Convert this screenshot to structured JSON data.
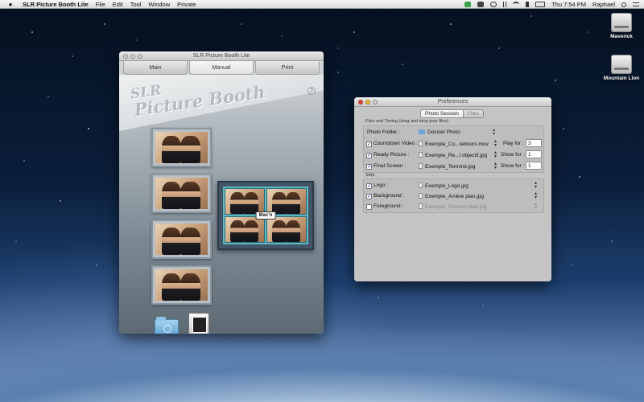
{
  "menubar": {
    "apple": "",
    "app_name": "SLR Picture Booth Lite",
    "items": [
      "File",
      "Edit",
      "Tool",
      "Window",
      "Private"
    ],
    "clock": "Thu 7:54 PM",
    "user": "Raphael"
  },
  "desktop": {
    "disks": [
      {
        "label": "Maverick"
      },
      {
        "label": "Mountain Lion"
      }
    ]
  },
  "main_window": {
    "title": "SLR Picture Booth Lite",
    "tabs": [
      "Main",
      "Manual",
      "Print"
    ],
    "active_tab": "Manual",
    "logo_line1": "SLR",
    "logo_line2": "Picture Booth",
    "help_label": "?",
    "strip_label": "Mac'n"
  },
  "preferences": {
    "title": "Preferences",
    "tabs": [
      "Photo Session",
      "Files"
    ],
    "active_tab": "Photo Session",
    "section1_title": "Files and Timing (drag and drop your files)",
    "section2_title": "Strip",
    "rows1": [
      {
        "label": "Photo Folder :",
        "value": "Dossier Photo",
        "checked": null,
        "extra_label": "",
        "extra_value": ""
      },
      {
        "label": "Countdown Video :",
        "value": "Exemple_Co...rebours.mov",
        "checked": true,
        "extra_label": "Play for :",
        "extra_value": "3"
      },
      {
        "label": "Ready Picture :",
        "value": "Exemple_Re...l objectif.jpg",
        "checked": true,
        "extra_label": "Show for :",
        "extra_value": "1"
      },
      {
        "label": "Final Screen :",
        "value": "Exemple_Terminé.jpg",
        "checked": true,
        "extra_label": "Show for :",
        "extra_value": "1"
      }
    ],
    "rows2": [
      {
        "label": "Logo :",
        "value": "Exemple_Logo.jpg",
        "checked": true
      },
      {
        "label": "Background :",
        "value": "Exemple_Arrière plan.jpg",
        "checked": true
      },
      {
        "label": "Foreground :",
        "value": "Exemple_Premier plan.jpg",
        "checked": false
      }
    ]
  }
}
